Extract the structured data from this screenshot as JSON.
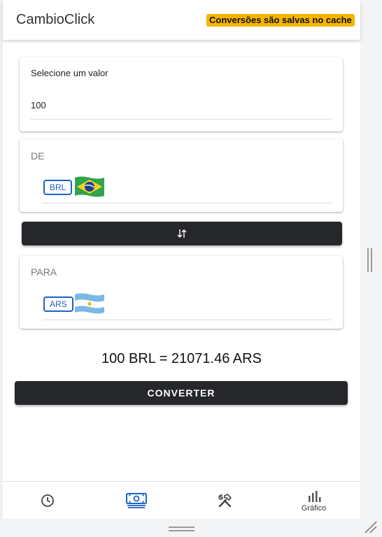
{
  "header": {
    "title": "CambioClick",
    "cache_notice": "Conversões são salvas no cache"
  },
  "amount_card": {
    "label": "Selecione um valor",
    "value": "100"
  },
  "from_card": {
    "label": "DE",
    "currency_code": "BRL",
    "flag": "brazil-flag"
  },
  "swap_button": {
    "icon": "swap-vertical-icon"
  },
  "to_card": {
    "label": "PARA",
    "currency_code": "ARS",
    "flag": "argentina-flag"
  },
  "result": {
    "text": "100 BRL = 21071.46 ARS"
  },
  "convert_button": {
    "label": "CONVERTER"
  },
  "bottom_nav": {
    "items": [
      {
        "icon": "history-clock-icon",
        "label": ""
      },
      {
        "icon": "money-icon",
        "label": "",
        "active": true
      },
      {
        "icon": "tools-icon",
        "label": ""
      },
      {
        "icon": "bar-chart-icon",
        "label": "Gráfico"
      }
    ]
  },
  "colors": {
    "accent_blue": "#1e63c4",
    "dark_button": "#25272b",
    "badge_yellow": "#f5b400"
  }
}
